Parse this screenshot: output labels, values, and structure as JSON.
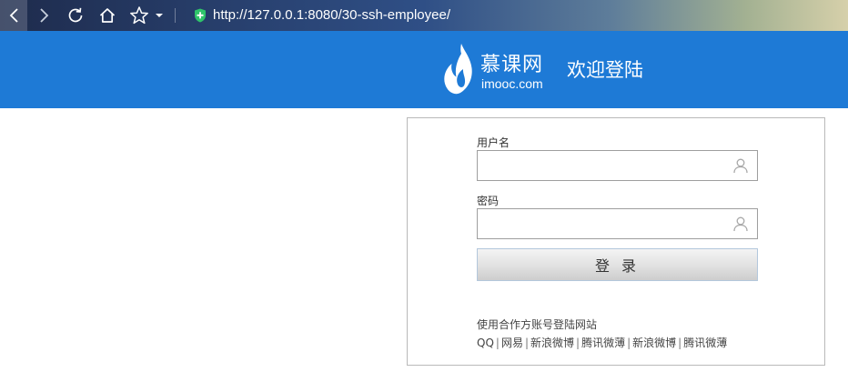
{
  "browser": {
    "url": "http://127.0.0.1:8080/30-ssh-employee/",
    "icons": [
      "back-icon",
      "forward-icon",
      "reload-icon",
      "home-icon",
      "star-icon",
      "dropdown-arrow-icon",
      "shield-icon"
    ]
  },
  "header": {
    "logo_cn": "慕课网",
    "logo_en": "imooc.com",
    "welcome": "欢迎登陆",
    "background": "#1e7ad6"
  },
  "login": {
    "username_label": "用户名",
    "username_value": "",
    "password_label": "密码",
    "password_value": "",
    "submit_label": "登 录",
    "third_party_title": "使用合作方账号登陆网站",
    "third_party_links": [
      "QQ",
      "网易",
      "新浪微博",
      "腾讯微薄",
      "新浪微博",
      "腾讯微薄"
    ],
    "separator": "|"
  }
}
